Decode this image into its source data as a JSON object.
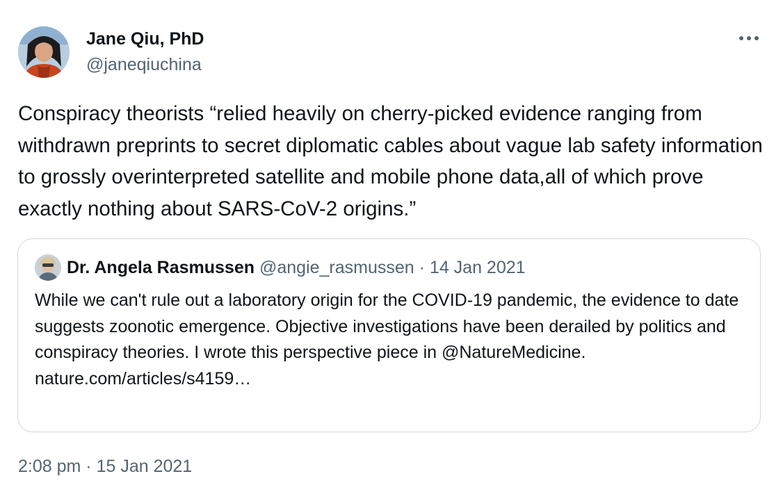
{
  "author": {
    "display_name": "Jane Qiu, PhD",
    "handle": "@janeqiuchina",
    "avatar_icon": "profile-photo-icon"
  },
  "tweet": {
    "text": "Conspiracy theorists “relied heavily on cherry-picked evidence ranging from withdrawn preprints to secret diplomatic cables about vague lab safety information to grossly overinterpreted satellite and mobile phone data,all of which prove exactly nothing about SARS-CoV-2 origins.”",
    "more_icon": "more-options-icon"
  },
  "quoted_tweet": {
    "display_name": "Dr. Angela Rasmussen",
    "handle": "@angie_rasmussen",
    "separator": "·",
    "date": "14 Jan 2021",
    "text": "While we can't rule out a laboratory origin for the COVID-19 pandemic, the evidence to date suggests zoonotic emergence. Objective investigations have been derailed by politics and conspiracy theories. I wrote this perspective piece in @NatureMedicine.",
    "link": "nature.com/articles/s4159…",
    "avatar_icon": "profile-photo-icon"
  },
  "footer": {
    "time": "2:08 pm",
    "separator": "·",
    "date": "15 Jan 2021"
  },
  "colors": {
    "text_primary": "#0f1419",
    "text_secondary": "#536471",
    "border": "#cfd9de"
  }
}
